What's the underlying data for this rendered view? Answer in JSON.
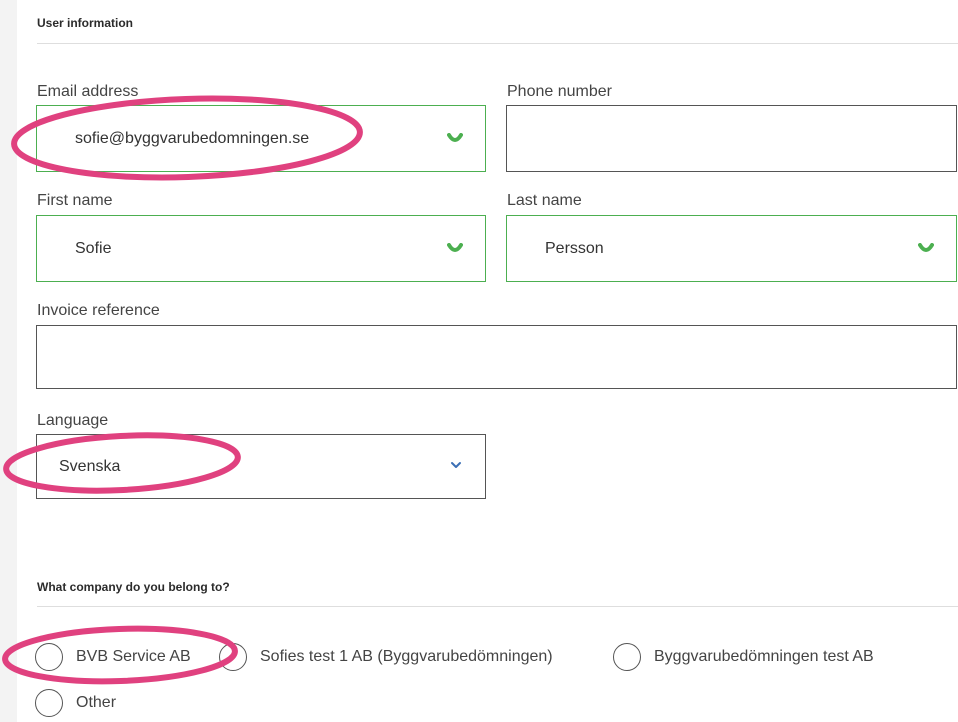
{
  "user_section": {
    "title": "User information"
  },
  "fields": {
    "email": {
      "label": "Email address",
      "value": "sofie@byggvarubedomningen.se",
      "valid": true
    },
    "phone": {
      "label": "Phone number",
      "value": ""
    },
    "first_name": {
      "label": "First name",
      "value": "Sofie",
      "valid": true
    },
    "last_name": {
      "label": "Last name",
      "value": "Persson",
      "valid": true
    },
    "invoice_reference": {
      "label": "Invoice reference",
      "value": ""
    },
    "language": {
      "label": "Language",
      "selected": "Svenska"
    }
  },
  "company_section": {
    "title": "What company do you belong to?",
    "options": [
      {
        "label": "BVB Service AB",
        "checked": false
      },
      {
        "label": "Sofies test 1 AB (Byggvarubedömningen)",
        "checked": false
      },
      {
        "label": "Byggvarubedömningen test AB",
        "checked": false
      },
      {
        "label": "Other",
        "checked": false
      }
    ]
  },
  "colors": {
    "valid": "#4caf50",
    "annotation": "#e0417f",
    "chevron": "#3b6fb5",
    "border": "#555555"
  },
  "icons": {
    "valid": "check-icon",
    "select": "chevron-down-icon",
    "radio": "radio-icon"
  }
}
